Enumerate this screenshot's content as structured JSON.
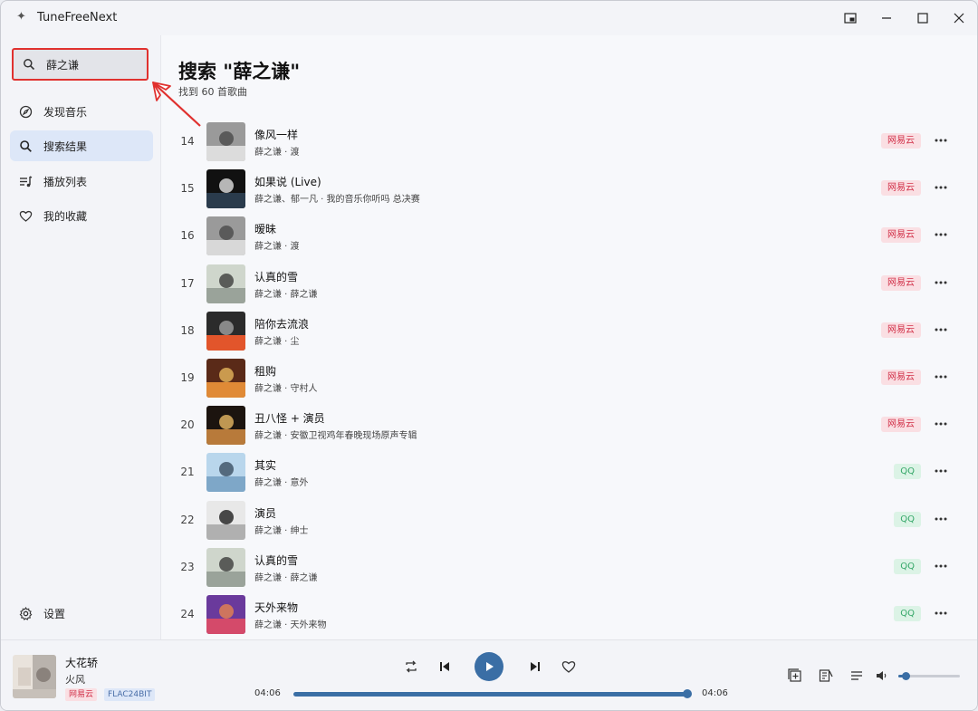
{
  "app": {
    "title": "TuneFreeNext"
  },
  "sidebar": {
    "search_value": "薛之谦",
    "items": [
      {
        "label": "发现音乐",
        "icon": "compass-icon"
      },
      {
        "label": "搜索结果",
        "icon": "search-icon",
        "active": true
      },
      {
        "label": "播放列表",
        "icon": "playlist-icon"
      },
      {
        "label": "我的收藏",
        "icon": "heart-icon"
      }
    ],
    "settings_label": "设置"
  },
  "main": {
    "title": "搜索 \"薛之谦\"",
    "subtitle": "找到 60 首歌曲",
    "songs": [
      {
        "num": "14",
        "title": "像风一样",
        "artist": "薛之谦 · 渡",
        "source": "网易云"
      },
      {
        "num": "15",
        "title": "如果说 (Live)",
        "artist": "薛之谦、郁一凡 · 我的音乐你听吗 总决赛",
        "source": "网易云"
      },
      {
        "num": "16",
        "title": "暧昧",
        "artist": "薛之谦 · 渡",
        "source": "网易云"
      },
      {
        "num": "17",
        "title": "认真的雪",
        "artist": "薛之谦 · 薛之谦",
        "source": "网易云"
      },
      {
        "num": "18",
        "title": "陪你去流浪",
        "artist": "薛之谦 · 尘",
        "source": "网易云"
      },
      {
        "num": "19",
        "title": "租购",
        "artist": "薛之谦 · 守村人",
        "source": "网易云"
      },
      {
        "num": "20",
        "title": "丑八怪 + 演员",
        "artist": "薛之谦 · 安徽卫视鸡年春晚现场原声专辑",
        "source": "网易云"
      },
      {
        "num": "21",
        "title": "其实",
        "artist": "薛之谦 · 意外",
        "source": "QQ"
      },
      {
        "num": "22",
        "title": "演员",
        "artist": "薛之谦 · 绅士",
        "source": "QQ"
      },
      {
        "num": "23",
        "title": "认真的雪",
        "artist": "薛之谦 · 薛之谦",
        "source": "QQ"
      },
      {
        "num": "24",
        "title": "天外来物",
        "artist": "薛之谦 · 天外来物",
        "source": "QQ"
      }
    ]
  },
  "player": {
    "title": "大花轿",
    "artist": "火风",
    "source": "网易云",
    "quality": "FLAC24BIT",
    "time_current": "04:06",
    "time_total": "04:06",
    "progress": 1.0,
    "volume": 0.12
  },
  "colors": {
    "accent": "#3a6ea5",
    "netease_badge_bg": "#fadfe3",
    "netease_badge_fg": "#d2324a",
    "qq_badge_bg": "#dcf3e6",
    "qq_badge_fg": "#37a86a",
    "annotation_red": "#e0312f"
  }
}
